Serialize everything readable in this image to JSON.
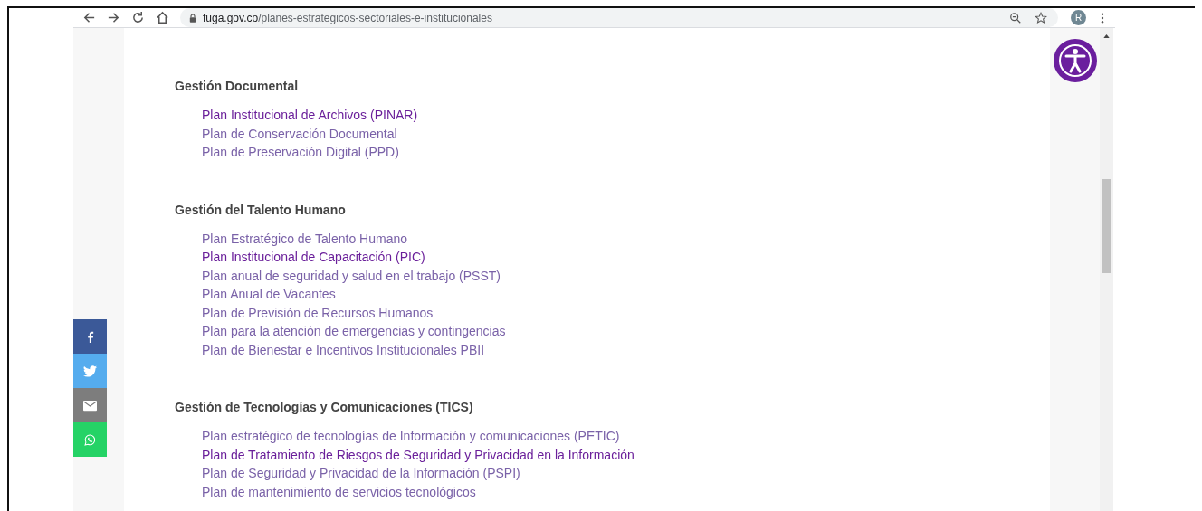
{
  "browser": {
    "url_domain": "fuga.gov.co",
    "url_path": "/planes-estrategicos-sectoriales-e-institucionales",
    "profile_initial": "R"
  },
  "sections": [
    {
      "title": "Gestión Documental",
      "links": [
        {
          "label": "Plan Institucional de Archivos (PINAR)",
          "visited": true
        },
        {
          "label": "Plan de Conservación Documental",
          "visited": false
        },
        {
          "label": "Plan de Preservación Digital  (PPD)",
          "visited": false
        }
      ]
    },
    {
      "title": "Gestión del Talento Humano",
      "links": [
        {
          "label": "Plan Estratégico de Talento Humano",
          "visited": false
        },
        {
          "label": "Plan Institucional de Capacitación (PIC)",
          "visited": true
        },
        {
          "label": "Plan anual de seguridad y salud en el trabajo (PSST)",
          "visited": false
        },
        {
          "label": "Plan Anual de Vacantes",
          "visited": false
        },
        {
          "label": "Plan de Previsión de Recursos Humanos",
          "visited": false
        },
        {
          "label": "Plan para la atención de emergencias y contingencias",
          "visited": false
        },
        {
          "label": "Plan de Bienestar e Incentivos Institucionales PBII",
          "visited": false
        }
      ]
    },
    {
      "title": "Gestión de Tecnologías y Comunicaciones (TICS)",
      "links": [
        {
          "label": "Plan estratégico de tecnologías de Información y comunicaciones (PETIC)",
          "visited": false
        },
        {
          "label": "Plan de Tratamiento de Riesgos de Seguridad y Privacidad en la Información",
          "visited": true
        },
        {
          "label": "Plan de Seguridad y Privacidad de la Información (PSPI)",
          "visited": false
        },
        {
          "label": "Plan de mantenimiento de servicios tecnológicos",
          "visited": false
        }
      ]
    }
  ],
  "share_buttons": [
    {
      "kind": "facebook",
      "color": "#3b5998"
    },
    {
      "kind": "twitter",
      "color": "#55acee"
    },
    {
      "kind": "email",
      "color": "#7d7d7d"
    },
    {
      "kind": "whatsapp",
      "color": "#25d366"
    }
  ]
}
